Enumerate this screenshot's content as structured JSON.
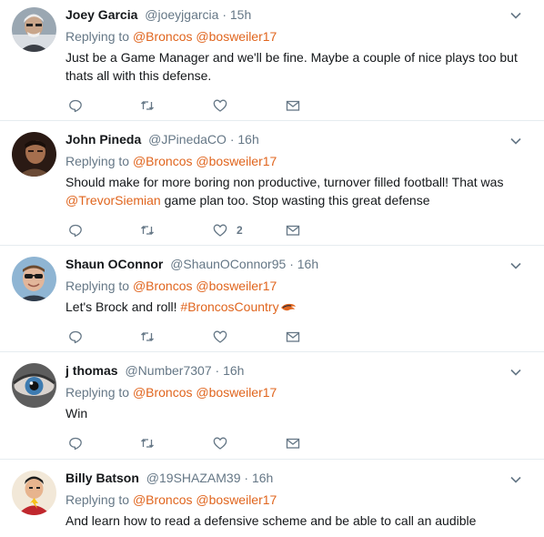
{
  "replying_prefix": "Replying to",
  "tweets": [
    {
      "name": "Joey Garcia",
      "handle": "@joeyjgarcia",
      "separator": "·",
      "time": "15h",
      "mentions": [
        "@Broncos",
        "@bosweiler17"
      ],
      "text": "Just be a Game Manager and we'll be fine.  Maybe a couple of nice plays too but thats all with this defense.",
      "likes": ""
    },
    {
      "name": "John Pineda",
      "handle": "@JPinedaCO",
      "separator": "·",
      "time": "16h",
      "mentions": [
        "@Broncos",
        "@bosweiler17"
      ],
      "text_part1": "Should make for more boring non productive, turnover filled football! That was",
      "text_link": "@TrevorSiemian",
      "text_part2": "game plan too. Stop wasting this great defense",
      "likes": "2"
    },
    {
      "name": "Shaun OConnor",
      "handle": "@ShaunOConnor95",
      "separator": "·",
      "time": "16h",
      "mentions": [
        "@Broncos",
        "@bosweiler17"
      ],
      "text_part1": "Let's Brock and roll!",
      "text_link": "#BroncosCountry",
      "likes": ""
    },
    {
      "name": "j thomas",
      "handle": "@Number7307",
      "separator": "·",
      "time": "16h",
      "mentions": [
        "@Broncos",
        "@bosweiler17"
      ],
      "text": "Win",
      "likes": ""
    },
    {
      "name": "Billy Batson",
      "handle": "@19SHAZAM39",
      "separator": "·",
      "time": "16h",
      "mentions": [
        "@Broncos",
        "@bosweiler17"
      ],
      "text": "And learn how to read a defensive scheme  and be able to call an audible",
      "likes": ""
    }
  ],
  "icons": {
    "reply": "reply-icon",
    "retweet": "retweet-icon",
    "like": "heart-icon",
    "dm": "envelope-icon",
    "caret": "chevron-down-icon",
    "hashflag": "broncos-logo-icon"
  },
  "colors": {
    "link": "#e0651e",
    "muted": "#657786",
    "text": "#14171a",
    "divider": "#e6ecf0"
  }
}
